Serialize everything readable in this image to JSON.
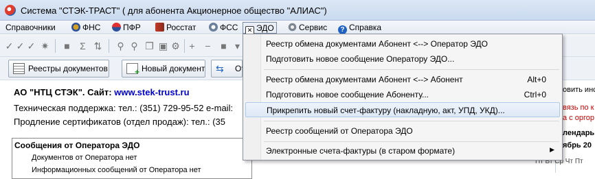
{
  "window": {
    "title": "Система \"СТЭК-ТРАСТ\" ( для абонента Акционерное общество \"АЛИАС\")"
  },
  "menubar": {
    "items": [
      {
        "label": "Справочники",
        "icon": "none"
      },
      {
        "label": "ФНС",
        "icon": "fns-icon"
      },
      {
        "label": "ПФР",
        "icon": "pfr-icon"
      },
      {
        "label": "Росстат",
        "icon": "rosstat-icon"
      },
      {
        "label": "ФСС",
        "icon": "fss-icon"
      },
      {
        "label": "ЭДО",
        "icon": "edo-envelope-icon"
      },
      {
        "label": "Сервис",
        "icon": "gear-icon"
      },
      {
        "label": "Справка",
        "icon": "help-icon"
      }
    ]
  },
  "toolbar2": {
    "registry_button": "Реестры документов",
    "new_doc_button": "Новый документ",
    "partial_button": "От"
  },
  "content": {
    "company_line_prefix": "АО \"НТЦ СТЭК\".  Сайт:",
    "company_site": "www.stek-trust.ru",
    "support_line": "Техническая поддержка: тел.: (351) 729-95-52 e-mail:",
    "cert_line": "Продление сертификатов (отдел продаж):  тел.: (35",
    "table_header": "Сообщения от Оператора ЭДО",
    "row1": "Документов от Оператора нет",
    "row2": "Информационных сообщений от Оператора нет"
  },
  "right_panel": {
    "line1": "овить инс",
    "line2": "вязь по к",
    "line3": "а с оргор",
    "line4": "лендарь",
    "line5": "ябрь 20",
    "days": "Пт  Вт  Ср  Чт  Пт"
  },
  "dropdown": {
    "items": [
      {
        "label": "Реестр обмена документами Абонент <--> Оператор ЭДО",
        "shortcut": ""
      },
      {
        "label": "Подготовить новое сообщение Оператору ЭДО...",
        "shortcut": ""
      },
      {
        "label": "Реестр обмена документами Абонент <--> Абонент",
        "shortcut": "Alt+0"
      },
      {
        "label": "Подготовить новое сообщение Абоненту...",
        "shortcut": "Ctrl+0"
      },
      {
        "label": "Прикрепить новый счет-фактуру (накладную, акт, УПД, УКД)...",
        "shortcut": ""
      },
      {
        "label": "Реестр сообщений от Оператора ЭДО",
        "shortcut": ""
      },
      {
        "label": "Электронные счета-фактуры (в старом формате)",
        "shortcut": ""
      }
    ]
  },
  "colors": {
    "link": "#0000cc",
    "red_text": "#cc0000",
    "highlight_border": "#aecbeb"
  }
}
